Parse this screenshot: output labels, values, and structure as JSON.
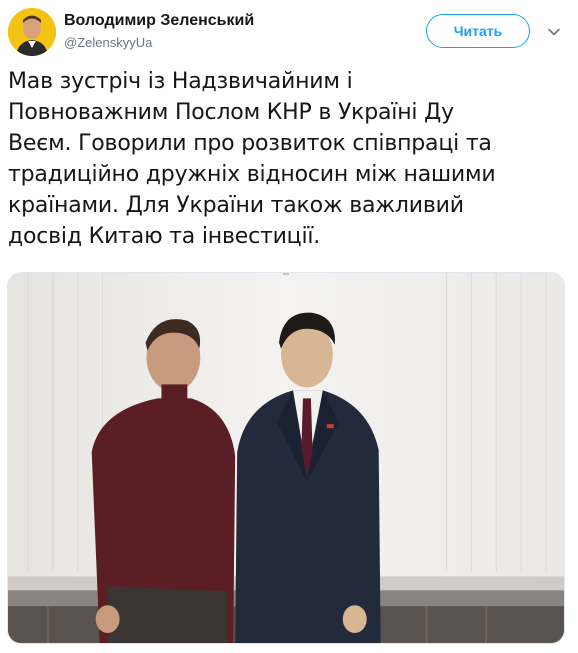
{
  "tweet": {
    "author_name": "Володимир Зеленський",
    "author_handle": "@ZelenskyyUa",
    "follow_label": "Читать",
    "text": "Мав зустріч із Надзвичайним і\nПовноважним Послом КНР в Україні Ду\nВеєм. Говорили про розвиток співпраці та\nтрадиційно дружніх відносин між нашими\nкраїнами. Для України також важливий\nдосвід Китаю та інвестиції.",
    "icons": {
      "avatar": "avatar",
      "more": "chevron-down-icon"
    },
    "colors": {
      "accent": "#1da1f2",
      "text": "#14171a",
      "secondary": "#657786"
    }
  }
}
